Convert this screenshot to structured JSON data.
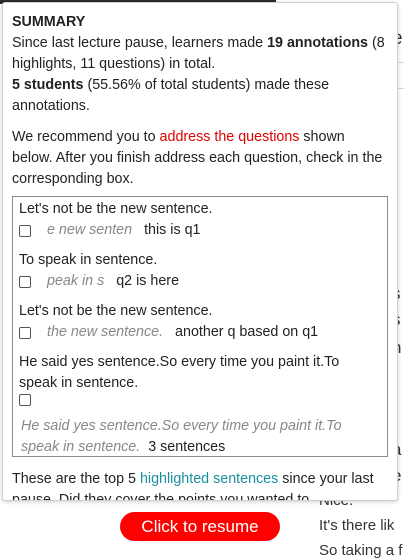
{
  "summary": {
    "title": "SUMMARY",
    "line1_a": "Since last lecture pause, learners made ",
    "line1_bold": "19 annotations",
    "line1_b": " (8 highlights, 11 questions) in total.",
    "line2_bold": "5 students",
    "line2_b": " (55.56% of total students) made these annotations."
  },
  "recommend": {
    "a": "We recommend you to ",
    "link": "address the questions",
    "b": " shown below. After you finish address each question, check in the corresponding box."
  },
  "questions": [
    {
      "sentence": "Let's not be the new sentence.",
      "highlight": "e new senten",
      "question": "this is q1",
      "checked": false
    },
    {
      "sentence": "To speak in sentence.",
      "highlight": "peak in s",
      "question": "q2 is here",
      "checked": false
    },
    {
      "sentence": "Let's not be the new sentence.",
      "highlight": "the new sentence.",
      "question": "another q based on q1",
      "checked": false
    },
    {
      "sentence": "He said yes sentence.So every time you paint it.To speak in sentence.",
      "highlight": "He said yes sentence.So every time you paint it.To speak in sentence.",
      "question": "3 sentences",
      "checked": false
    }
  ],
  "top_highlights": {
    "a": "These are the top 5 ",
    "link": "highlighted sentences",
    "b": " since your last pause. Did they cover the points you wanted to"
  },
  "resume_button": "Click to resume",
  "background": {
    "bottom_lines": [
      "Nice.",
      "It's there lik",
      "So taking a f"
    ]
  },
  "colors": {
    "accent_red": "#ff0000",
    "link_red": "#e00000",
    "link_teal": "#1a8fa0"
  }
}
